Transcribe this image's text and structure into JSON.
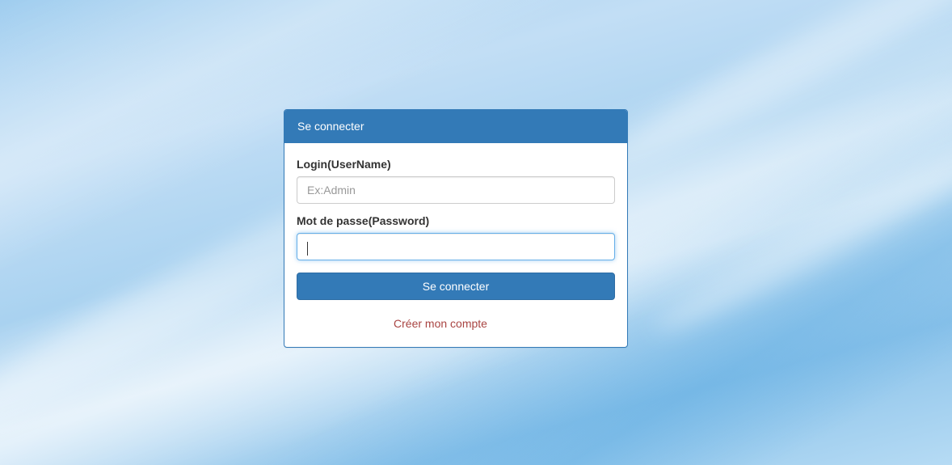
{
  "panel": {
    "title": "Se connecter"
  },
  "form": {
    "username_label": "Login(UserName)",
    "username_placeholder": "Ex:Admin",
    "username_value": "",
    "password_label": "Mot de passe(Password)",
    "password_value": "",
    "submit_label": "Se connecter",
    "create_account_label": "Créer mon compte"
  },
  "colors": {
    "primary": "#337ab7",
    "link": "#a94442",
    "focus": "#66afe9"
  }
}
